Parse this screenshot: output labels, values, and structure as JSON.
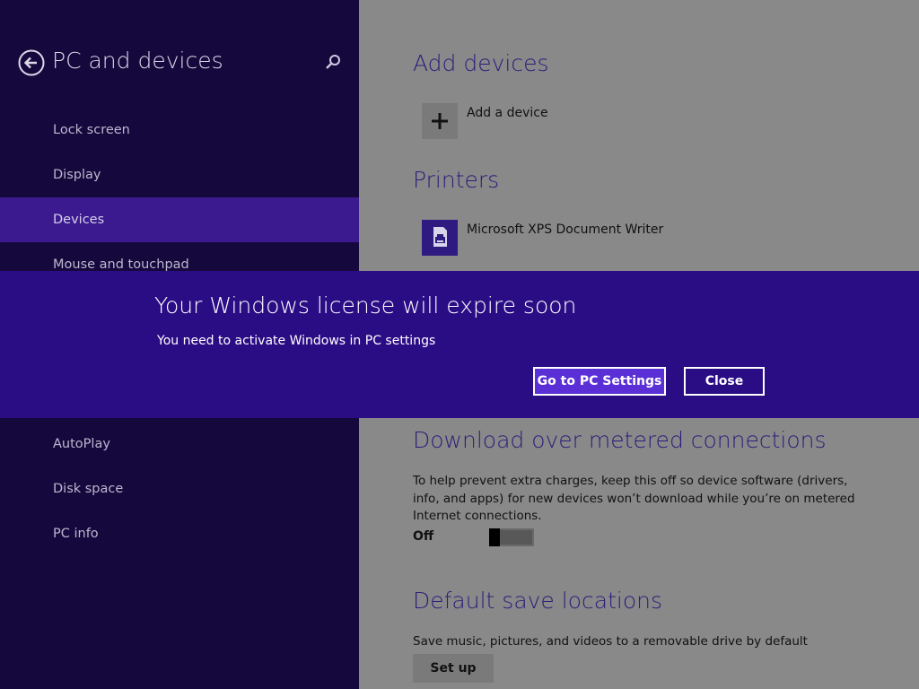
{
  "sidebar": {
    "title": "PC and devices",
    "back_icon": "back-arrow-circle-icon",
    "search_icon": "search-icon",
    "items": [
      {
        "label": "Lock screen"
      },
      {
        "label": "Display"
      },
      {
        "label": "Devices",
        "active": true
      },
      {
        "label": "Mouse and touchpad"
      },
      {
        "label": "AutoPlay"
      },
      {
        "label": "Disk space"
      },
      {
        "label": "PC info"
      }
    ]
  },
  "main": {
    "add_devices": {
      "title": "Add devices",
      "add_label": "Add a device",
      "icon": "plus-icon"
    },
    "printers": {
      "title": "Printers",
      "printer_label": "Microsoft XPS Document Writer",
      "icon": "printer-icon"
    },
    "metered": {
      "title": "Download over metered connections",
      "description": "To help prevent extra charges, keep this off so device software (drivers, info, and apps) for new devices won’t download while you’re on metered Internet connections.",
      "toggle_state": "Off"
    },
    "save_locations": {
      "title": "Default save locations",
      "description": "Save music, pictures, and videos to a removable drive by default",
      "button": "Set up"
    }
  },
  "banner": {
    "title": "Your Windows license will expire soon",
    "message": "You need to activate Windows in PC settings",
    "primary_button": "Go to PC Settings",
    "secondary_button": "Close"
  },
  "colors": {
    "sidebar_bg": "#15083d",
    "sidebar_active": "#3b1a8f",
    "banner_bg": "#2a0c85",
    "accent_title": "#2c1d7a",
    "content_bg": "#898989"
  }
}
